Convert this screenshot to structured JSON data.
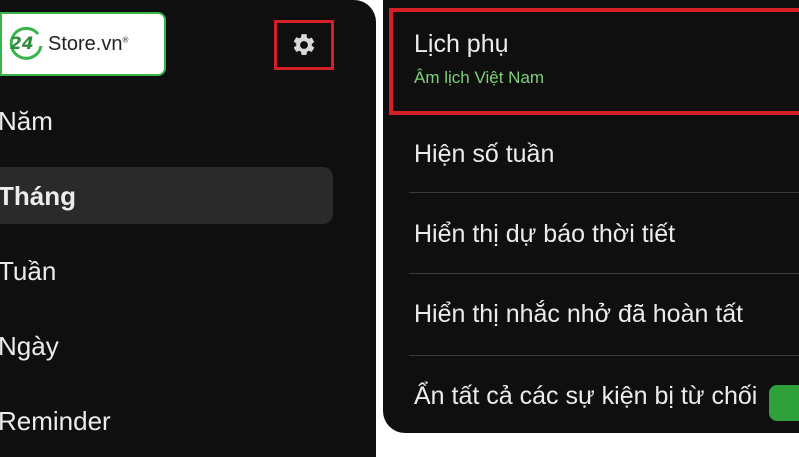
{
  "logo": {
    "badge_number": "24",
    "text": "Store.vn",
    "registered": "®"
  },
  "left": {
    "nav": [
      {
        "label": "Năm"
      },
      {
        "label": "Tháng"
      },
      {
        "label": "Tuần"
      },
      {
        "label": "Ngày"
      },
      {
        "label": "Reminder"
      }
    ],
    "active_index": 1
  },
  "right": {
    "settings": [
      {
        "title": "Lịch phụ",
        "subtitle": "Âm lịch Việt Nam"
      },
      {
        "title": "Hiện số tuần"
      },
      {
        "title": "Hiển thị dự báo thời tiết"
      },
      {
        "title": "Hiển thị nhắc nhở đã hoàn tất"
      },
      {
        "title": "Ẩn tất cả các sự kiện bị từ chối"
      }
    ]
  },
  "colors": {
    "highlight": "#d61f26",
    "subtitle": "#7fd07a",
    "brand_green": "#2fa13b",
    "background": "#0f0f0f"
  }
}
